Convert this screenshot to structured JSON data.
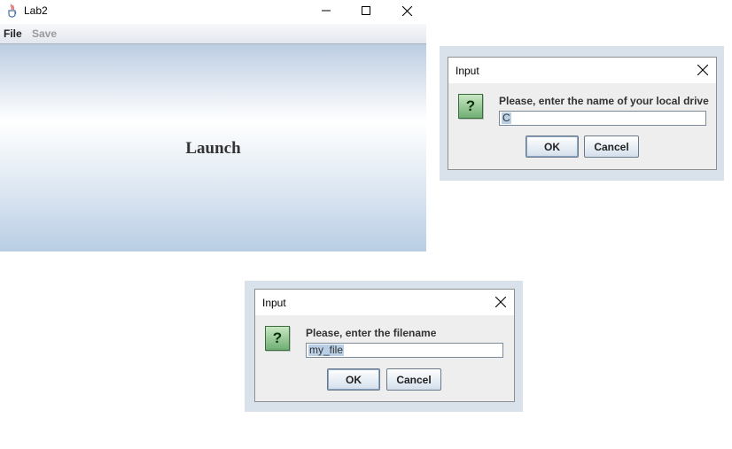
{
  "main": {
    "title": "Lab2",
    "menu": {
      "file": "File",
      "save": "Save"
    },
    "launch_label": "Launch"
  },
  "dialog_drive": {
    "title": "Input",
    "prompt": "Please, enter the name of your local drive",
    "value": "C",
    "ok": "OK",
    "cancel": "Cancel"
  },
  "dialog_file": {
    "title": "Input",
    "prompt": "Please, enter the filename",
    "value": "my_file",
    "ok": "OK",
    "cancel": "Cancel"
  },
  "icons": {
    "app": "java-cup-icon",
    "question": "question-icon",
    "question_glyph": "?"
  },
  "colors": {
    "menubar": "#e3e7ee",
    "content_gradient_top": "#bccde2",
    "content_gradient_bottom": "#b8cde4",
    "question_icon": "#6fae73",
    "selection": "#b8cfe5"
  }
}
